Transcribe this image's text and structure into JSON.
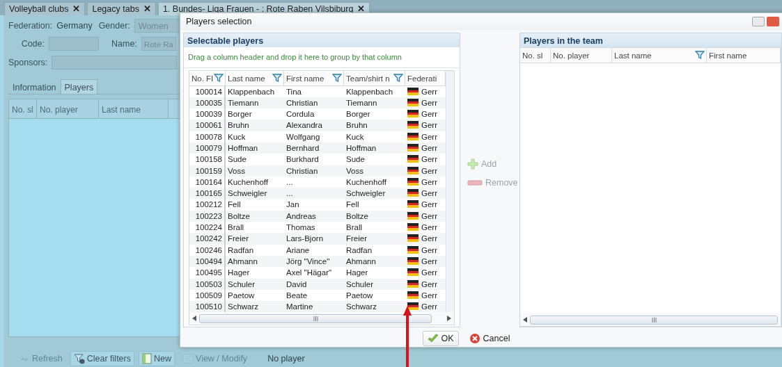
{
  "app_tabs": [
    {
      "label": "Volleyball clubs",
      "close": "✕",
      "selected": false
    },
    {
      "label": "Legacy tabs",
      "close": "✕",
      "selected": false
    },
    {
      "label": "1. Bundes- Liga Frauen - : Rote Raben Vilsbiburg",
      "close": "✕",
      "selected": true
    }
  ],
  "club_form": {
    "federation_label": "Federation:",
    "federation_value": "Germany",
    "gender_label": "Gender:",
    "gender_value": "Women",
    "code_label": "Code:",
    "name_label": "Name:",
    "name_value": "Rote Ra",
    "sponsors_label": "Sponsors:"
  },
  "club_tabs": [
    {
      "label": "Information",
      "selected": false
    },
    {
      "label": "Players",
      "selected": true
    }
  ],
  "club_grid": {
    "columns": [
      "No. sl",
      "No. player",
      "Last name"
    ]
  },
  "toolbar": [
    {
      "label": "Refresh",
      "disabled": true
    },
    {
      "label": "Clear filters",
      "disabled": false
    },
    {
      "label": "New",
      "disabled": false
    },
    {
      "label": "View / Modify",
      "disabled": true
    }
  ],
  "toolbar_status": "No player",
  "dialog": {
    "title": "Players selection",
    "selectable": {
      "title": "Selectable players",
      "group_hint": "Drag a column header and drop it here to group by that column",
      "columns": [
        {
          "label": "No. FI",
          "filter": true
        },
        {
          "label": "Last name",
          "filter": true
        },
        {
          "label": "First name",
          "filter": true
        },
        {
          "label": "Team/shirt n",
          "filter": true
        },
        {
          "label": "Federati",
          "filter": false
        }
      ],
      "rows": [
        [
          "100014",
          "Klappenbach",
          "Tina",
          "Klappenbach",
          "Gerr"
        ],
        [
          "100035",
          "Tiemann",
          "Christian",
          "Tiemann",
          "Gerr"
        ],
        [
          "100039",
          "Borger",
          "Cordula",
          "Borger",
          "Gerr"
        ],
        [
          "100061",
          "Bruhn",
          "Alexandra",
          "Bruhn",
          "Gerr"
        ],
        [
          "100078",
          "Kuck",
          "Wolfgang",
          "Kuck",
          "Gerr"
        ],
        [
          "100079",
          "Hoffman",
          "Bernhard",
          "Hoffman",
          "Gerr"
        ],
        [
          "100158",
          "Sude",
          "Burkhard",
          "Sude",
          "Gerr"
        ],
        [
          "100159",
          "Voss",
          "Christian",
          "Voss",
          "Gerr"
        ],
        [
          "100164",
          "Kuchenhoff",
          "...",
          "Kuchenhoff",
          "Gerr"
        ],
        [
          "100165",
          "Schweigler",
          "...",
          "Schweigler",
          "Gerr"
        ],
        [
          "100212",
          "Fell",
          "Jan",
          "Fell",
          "Gerr"
        ],
        [
          "100223",
          "Boltze",
          "Andreas",
          "Boltze",
          "Gerr"
        ],
        [
          "100224",
          "Brall",
          "Thomas",
          "Brall",
          "Gerr"
        ],
        [
          "100242",
          "Freier",
          "Lars-Bjorn",
          "Freier",
          "Gerr"
        ],
        [
          "100246",
          "Radfan",
          "Ariane",
          "Radfan",
          "Gerr"
        ],
        [
          "100494",
          "Ahmann",
          "Jörg \"Vince\"",
          "Ahmann",
          "Gerr"
        ],
        [
          "100495",
          "Hager",
          "Axel \"Hägar\"",
          "Hager",
          "Gerr"
        ],
        [
          "100503",
          "Schuler",
          "David",
          "Schuler",
          "Gerr"
        ],
        [
          "100509",
          "Paetow",
          "Beate",
          "Paetow",
          "Gerr"
        ],
        [
          "100510",
          "Schwarz",
          "Martine",
          "Schwarz",
          "Gerr"
        ]
      ]
    },
    "transfer_buttons": [
      {
        "label": "Add",
        "disabled": true
      },
      {
        "label": "Remove",
        "disabled": true
      }
    ],
    "team": {
      "title": "Players in the team",
      "columns": [
        {
          "label": "No. sl",
          "filter": false
        },
        {
          "label": "No. player",
          "filter": false
        },
        {
          "label": "Last name",
          "filter": true
        },
        {
          "label": "First name",
          "filter": false
        }
      ]
    },
    "footer_buttons": [
      {
        "label": "OK"
      },
      {
        "label": "Cancel"
      }
    ]
  }
}
